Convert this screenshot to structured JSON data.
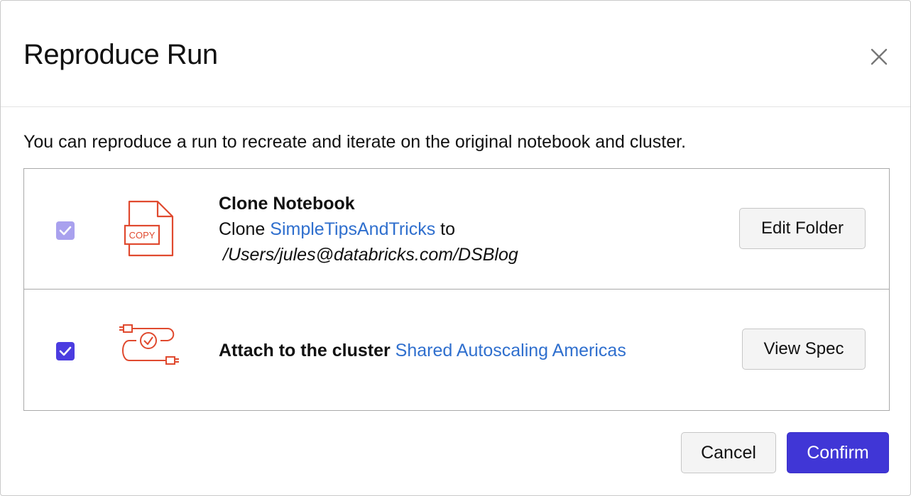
{
  "dialog": {
    "title": "Reproduce Run",
    "close_icon": "close-icon",
    "intro": "You can reproduce a run to recreate and iterate on the original notebook and cluster."
  },
  "options": [
    {
      "checked": true,
      "checkbox_state": "disabled",
      "icon": "copy-file-icon",
      "icon_text": "COPY",
      "title": "Clone Notebook",
      "prefix": "Clone",
      "link": "SimpleTipsAndTricks",
      "suffix": "to",
      "path": "/Users/jules@databricks.com/DSBlog",
      "button_label": "Edit Folder"
    },
    {
      "checked": true,
      "checkbox_state": "enabled",
      "icon": "cluster-cable-icon",
      "title": "Attach to the cluster",
      "link": "Shared Autoscaling Americas",
      "button_label": "View Spec"
    }
  ],
  "footer": {
    "cancel_label": "Cancel",
    "confirm_label": "Confirm"
  },
  "colors": {
    "accent": "#4036d6",
    "checkbox_disabled": "#a9a1ee",
    "link": "#2f6fce",
    "icon": "#e04a2f"
  }
}
